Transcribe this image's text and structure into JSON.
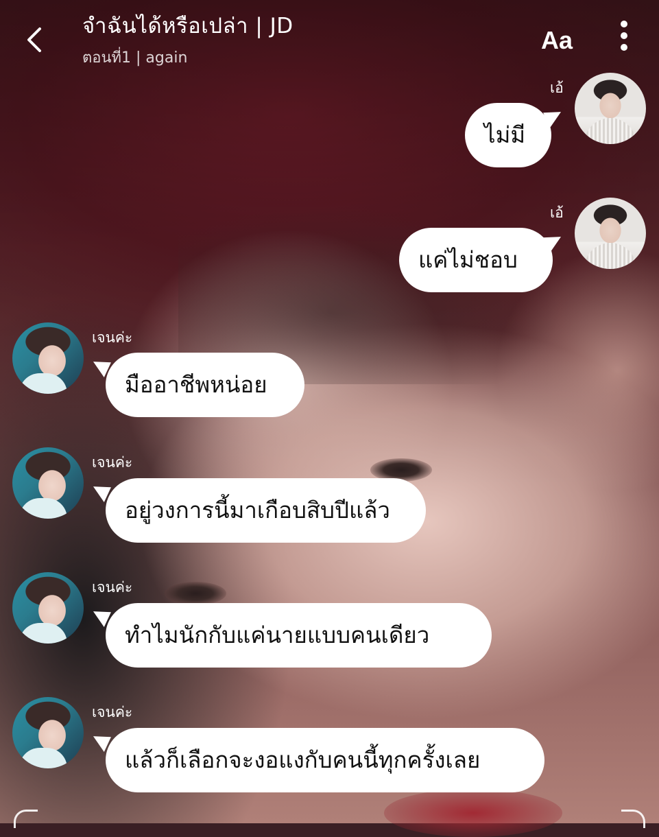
{
  "header": {
    "title": "จำฉันได้หรือเปล่า  |  JD",
    "subtitle": "ตอนที่1 | again",
    "font_button": "Aa"
  },
  "messages": [
    {
      "side": "right",
      "sender": "เอ้",
      "text": "ไม่มี"
    },
    {
      "side": "right",
      "sender": "เอ้",
      "text": "แค่ไม่ชอบ"
    },
    {
      "side": "left",
      "sender": "เจนค่ะ",
      "text": "มืออาชีพหน่อย"
    },
    {
      "side": "left",
      "sender": "เจนค่ะ",
      "text": "อยู่วงการนี้มาเกือบสิบปีแล้ว"
    },
    {
      "side": "left",
      "sender": "เจนค่ะ",
      "text": "ทำไมนักกับแค่นายแบบคนเดียว"
    },
    {
      "side": "left",
      "sender": "เจนค่ะ",
      "text": "แล้วก็เลือกจะงอแงกับคนนี้ทุกครั้งเลย"
    }
  ],
  "icons": {
    "back": "chevron-left-icon",
    "more": "more-vertical-icon"
  }
}
